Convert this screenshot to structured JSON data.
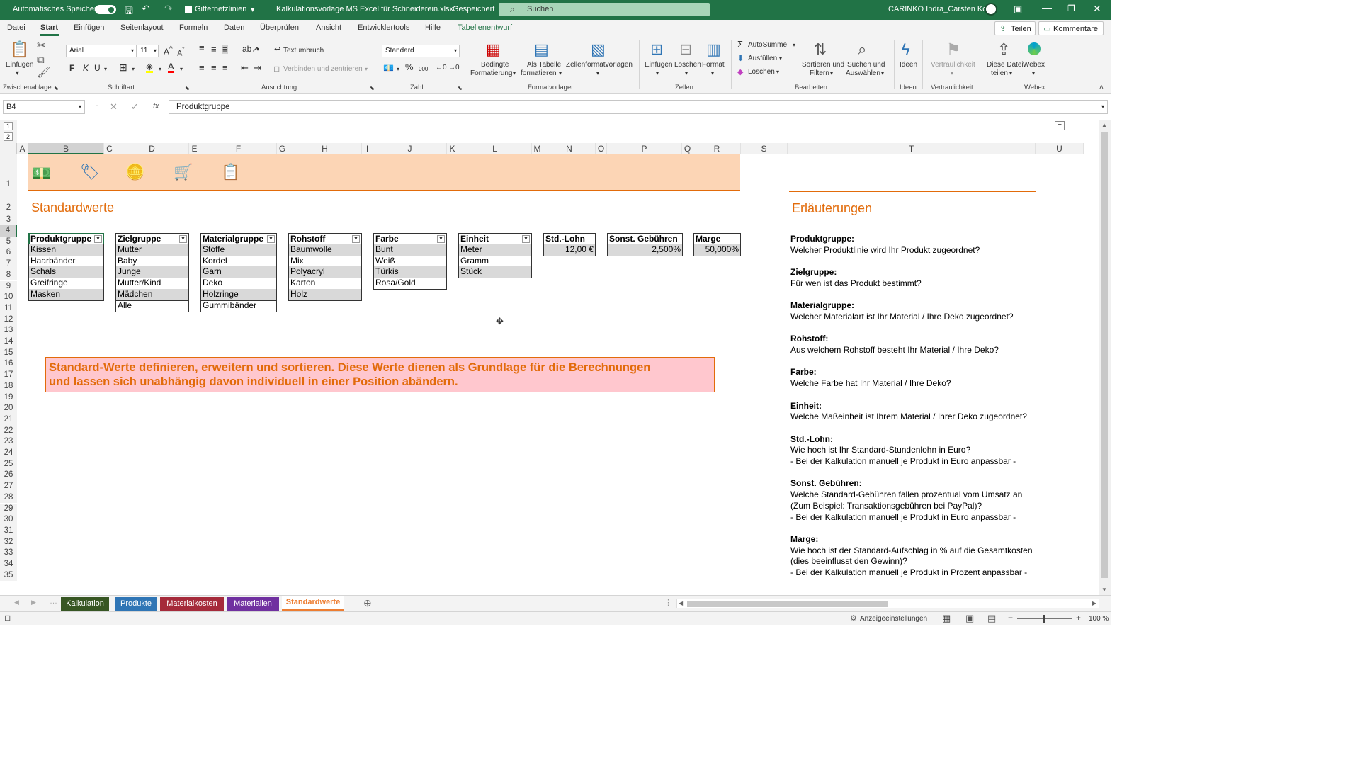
{
  "titlebar": {
    "autosave": "Automatisches Speichern",
    "gridlines": "Gitternetzlinien",
    "filename": "Kalkulationsvorlage MS Excel für Schneiderein.xlsx",
    "saved": "Gespeichert",
    "search": "Suchen",
    "user": "CARINKO Indra_Carsten Kohl",
    "accent": "#217346"
  },
  "menu": [
    "Datei",
    "Start",
    "Einfügen",
    "Seitenlayout",
    "Formeln",
    "Daten",
    "Überprüfen",
    "Ansicht",
    "Entwicklertools",
    "Hilfe",
    "Tabellenentwurf"
  ],
  "menu_right": {
    "share": "Teilen",
    "comments": "Kommentare"
  },
  "ribbon": {
    "paste": "Einfügen",
    "font": "Arial",
    "size": "11",
    "wrap": "Textumbruch",
    "merge": "Verbinden und zentrieren",
    "format": "Standard",
    "cond1": "Bedingte",
    "cond2": "Formatierung",
    "tab1": "Als Tabelle",
    "tab2": "formatieren",
    "cellstyles": "Zellenformatvorlagen",
    "insert": "Einfügen",
    "delete": "Löschen",
    "fmt": "Format",
    "autosum": "AutoSumme",
    "fill": "Ausfüllen",
    "clear": "Löschen",
    "sort1": "Sortieren und",
    "sort2": "Filtern",
    "find1": "Suchen und",
    "find2": "Auswählen",
    "ideas": "Ideen",
    "conf": "Vertraulichkeit",
    "share1": "Diese Datei",
    "share2": "teilen",
    "webex": "Webex",
    "groups": [
      "Zwischenablage",
      "Schriftart",
      "Ausrichtung",
      "Zahl",
      "Formatvorlagen",
      "Zellen",
      "Bearbeiten",
      "Ideen",
      "Vertraulichkeit",
      "Webex"
    ]
  },
  "formula": {
    "namebox": "B4",
    "fx": "fx",
    "content": "Produktgruppe"
  },
  "columns": [
    "A",
    "B",
    "C",
    "D",
    "E",
    "F",
    "G",
    "H",
    "I",
    "J",
    "K",
    "L",
    "M",
    "N",
    "O",
    "P",
    "Q",
    "R",
    "S",
    "T",
    "U"
  ],
  "rows": [
    "1",
    "2",
    "3",
    "4",
    "5",
    "6",
    "7",
    "8",
    "9",
    "10",
    "11",
    "12",
    "13",
    "14",
    "15",
    "16",
    "17",
    "18",
    "19",
    "20",
    "21",
    "22",
    "23",
    "24",
    "25",
    "26",
    "27",
    "28",
    "29",
    "30",
    "31",
    "32",
    "33",
    "34",
    "35"
  ],
  "outline": [
    "1",
    "2"
  ],
  "title": "Standardwerte",
  "exp_title": "Erläuterungen",
  "tables": {
    "produkt": {
      "header": "Produktgruppe",
      "items": [
        "Kissen",
        "Haarbänder",
        "Schals",
        "Greifringe",
        "Masken"
      ]
    },
    "ziel": {
      "header": "Zielgruppe",
      "items": [
        "Mutter",
        "Baby",
        "Junge",
        "Mutter/Kind",
        "Mädchen",
        "Alle"
      ]
    },
    "material": {
      "header": "Materialgruppe",
      "items": [
        "Stoffe",
        "Kordel",
        "Garn",
        "Deko",
        "Holzringe",
        "Gummibänder"
      ]
    },
    "rohstoff": {
      "header": "Rohstoff",
      "items": [
        "Baumwolle",
        "Mix",
        "Polyacryl",
        "Karton",
        "Holz"
      ]
    },
    "farbe": {
      "header": "Farbe",
      "items": [
        "Bunt",
        "Weiß",
        "Türkis",
        "Rosa/Gold"
      ]
    },
    "einheit": {
      "header": "Einheit",
      "items": [
        "Meter",
        "Gramm",
        "Stück"
      ]
    },
    "lohn": {
      "header": "Std.-Lohn",
      "value": "12,00 €"
    },
    "gebuehr": {
      "header": "Sonst. Gebühren",
      "value": "2,500%"
    },
    "marge": {
      "header": "Marge",
      "value": "50,000%"
    }
  },
  "notice": {
    "line1": "Standard-Werte definieren, erweitern und sortieren. Diese Werte dienen als Grundlage für die Berechnungen",
    "line2": "und lassen sich unabhängig davon individuell in einer Position abändern."
  },
  "explanations": [
    {
      "h": "Produktgruppe:",
      "lines": [
        "Welcher Produktlinie wird Ihr Produkt zugeordnet?"
      ]
    },
    {
      "h": "Zielgruppe:",
      "lines": [
        "Für wen ist das Produkt bestimmt?"
      ]
    },
    {
      "h": "Materialgruppe:",
      "lines": [
        "Welcher Materialart ist Ihr Material / Ihre Deko zugeordnet?"
      ]
    },
    {
      "h": "Rohstoff:",
      "lines": [
        "Aus welchem Rohstoff besteht Ihr Material / Ihre Deko?"
      ]
    },
    {
      "h": "Farbe:",
      "lines": [
        "Welche Farbe hat Ihr Material / Ihre Deko?"
      ]
    },
    {
      "h": "Einheit:",
      "lines": [
        "Welche Maßeinheit ist Ihrem Material / Ihrer Deko zugeordnet?"
      ]
    },
    {
      "h": "Std.-Lohn:",
      "lines": [
        "Wie hoch ist Ihr Standard-Stundenlohn in Euro?",
        "- Bei der Kalkulation manuell je Produkt in Euro anpassbar -"
      ]
    },
    {
      "h": "Sonst. Gebühren:",
      "lines": [
        "Welche Standard-Gebühren fallen prozentual vom Umsatz an",
        "(Zum Beispiel: Transaktionsgebühren bei PayPal)?",
        "- Bei der Kalkulation manuell je Produkt in Euro anpassbar -"
      ]
    },
    {
      "h": "Marge:",
      "lines": [
        "Wie hoch ist der Standard-Aufschlag in % auf die Gesamtkosten",
        "(dies beeinflusst den Gewinn)?",
        "- Bei der Kalkulation manuell je Produkt in Prozent anpassbar -"
      ]
    }
  ],
  "sheets": [
    {
      "name": "Kalkulation",
      "color": "#375623"
    },
    {
      "name": "Produkte",
      "color": "#2f75b5"
    },
    {
      "name": "Materialkosten",
      "color": "#a52a3a"
    },
    {
      "name": "Materialien",
      "color": "#7030a0"
    },
    {
      "name": "Standardwerte",
      "color": "#ed7d31"
    }
  ],
  "status": {
    "display": "Anzeigeeinstellungen",
    "zoom": "100 %"
  },
  "colors": {
    "orange": "#e26b0a",
    "banner": "#fcd5b5",
    "notice_bg": "#ffc7ce"
  }
}
